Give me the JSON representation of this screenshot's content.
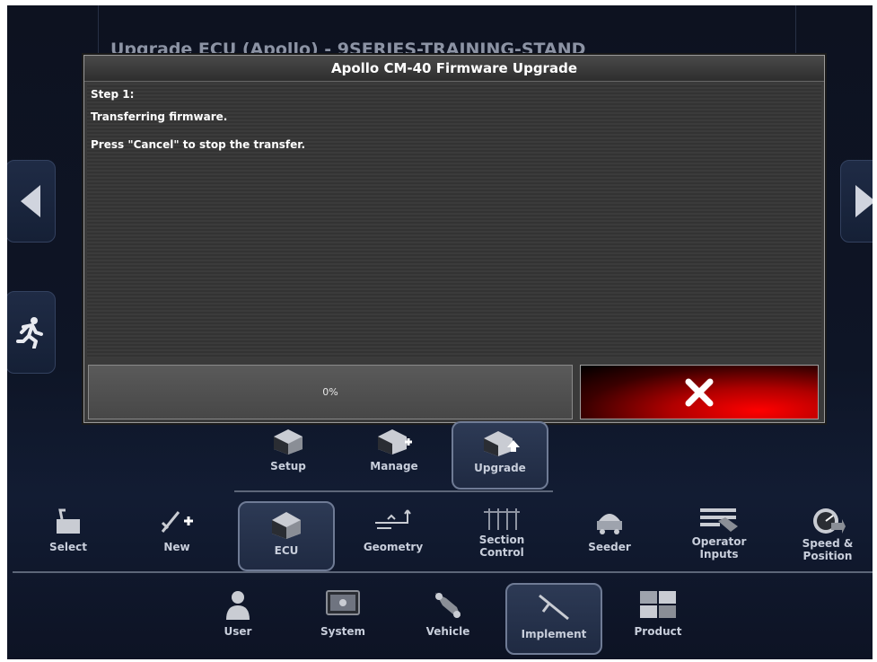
{
  "screen": {
    "title": "Upgrade ECU (Apollo) - 9SERIES-TRAINING-STAND"
  },
  "side_nav": {
    "left_icon": "chevron-left-icon",
    "right_icon": "chevron-right-icon",
    "exit_icon": "running-person-icon"
  },
  "dialog": {
    "title": "Apollo CM-40 Firmware Upgrade",
    "step_label": "Step 1:",
    "message": "Transferring firmware.",
    "instruction": "Press \"Cancel\" to stop the transfer.",
    "progress_text": "0%",
    "progress_value": 0,
    "cancel_icon": "close-icon",
    "cancel_color": "#ff0000"
  },
  "ecu_tabs": [
    {
      "label": "Setup",
      "icon": "ecu-setup-icon"
    },
    {
      "label": "Manage",
      "icon": "ecu-manage-icon"
    },
    {
      "label": "Upgrade",
      "icon": "ecu-upgrade-icon",
      "selected": true
    }
  ],
  "implement_tabs": [
    {
      "label": "Select",
      "icon": "select-icon"
    },
    {
      "label": "New",
      "icon": "new-icon"
    },
    {
      "label": "ECU",
      "icon": "ecu-icon",
      "selected": true
    },
    {
      "label": "Geometry",
      "icon": "geometry-icon"
    },
    {
      "label": "Section Control",
      "label_line1": "Section",
      "label_line2": "Control",
      "icon": "section-control-icon"
    },
    {
      "label": "Seeder",
      "icon": "seeder-icon"
    },
    {
      "label": "Operator Inputs",
      "label_line1": "Operator",
      "label_line2": "Inputs",
      "icon": "operator-inputs-icon"
    },
    {
      "label": "Speed & Position",
      "label_line1": "Speed &",
      "label_line2": "Position",
      "icon": "speed-position-icon"
    }
  ],
  "main_tabs": [
    {
      "label": "User",
      "icon": "user-icon"
    },
    {
      "label": "System",
      "icon": "system-icon"
    },
    {
      "label": "Vehicle",
      "icon": "vehicle-icon"
    },
    {
      "label": "Implement",
      "icon": "implement-icon",
      "selected": true
    },
    {
      "label": "Product",
      "icon": "product-icon"
    }
  ]
}
